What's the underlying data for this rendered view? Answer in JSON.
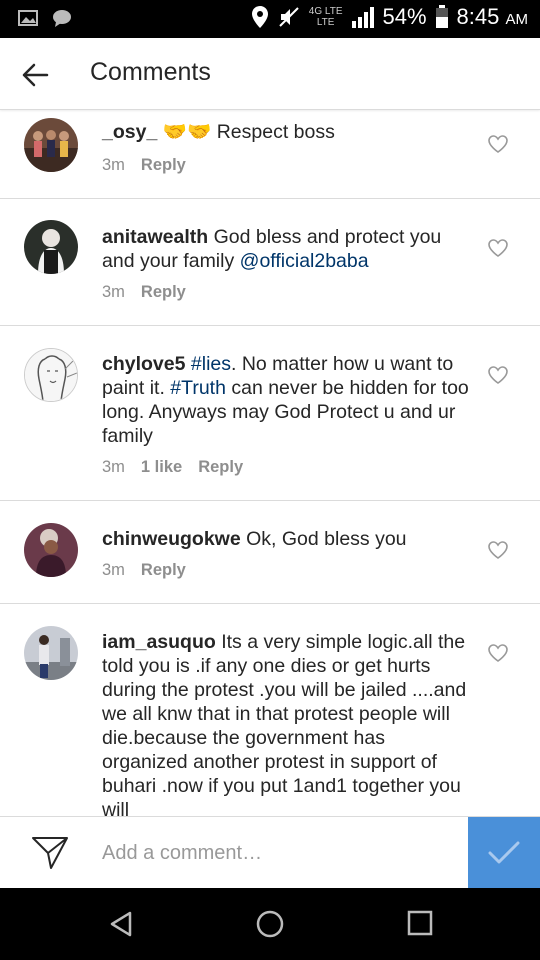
{
  "status_bar": {
    "network": "4G LTE",
    "network_sub": "LTE",
    "battery": "54%",
    "time": "8:45",
    "ampm": "AM"
  },
  "header": {
    "title": "Comments",
    "back_icon": "arrow-left-icon"
  },
  "comments": [
    {
      "username": "_osy_",
      "emoji": "🤝🤝",
      "text": " Respect boss",
      "time": "3m",
      "likes": "",
      "reply": "Reply"
    },
    {
      "username": "anitawealth",
      "text_before": " God bless and protect you and your family ",
      "mention": "@official2baba",
      "time": "3m",
      "likes": "",
      "reply": "Reply"
    },
    {
      "username": "chylove5",
      "hashtag1": "#lies",
      "text_mid": ". No matter how u want to paint it. ",
      "hashtag2": "#Truth",
      "text_end": " can never be hidden for too long. Anyways may God Protect u and ur family",
      "time": "3m",
      "likes": "1 like",
      "reply": "Reply"
    },
    {
      "username": "chinweugokwe",
      "text": " Ok, God bless you",
      "time": "3m",
      "likes": "",
      "reply": "Reply"
    },
    {
      "username": "iam_asuquo",
      "text": " Its a very simple logic.all the told you is .if any one dies or get hurts during the protest .you will be jailed ....and we all knw that in that protest people will die.because the government has organized another protest in support of buhari .now if you put 1and1 together you will"
    }
  ],
  "composer": {
    "placeholder": "Add a comment…",
    "accent": "#4a90d9"
  },
  "colors": {
    "hashtag": "#003569",
    "meta": "#8e8e8e",
    "divider": "#dbdbdb"
  }
}
